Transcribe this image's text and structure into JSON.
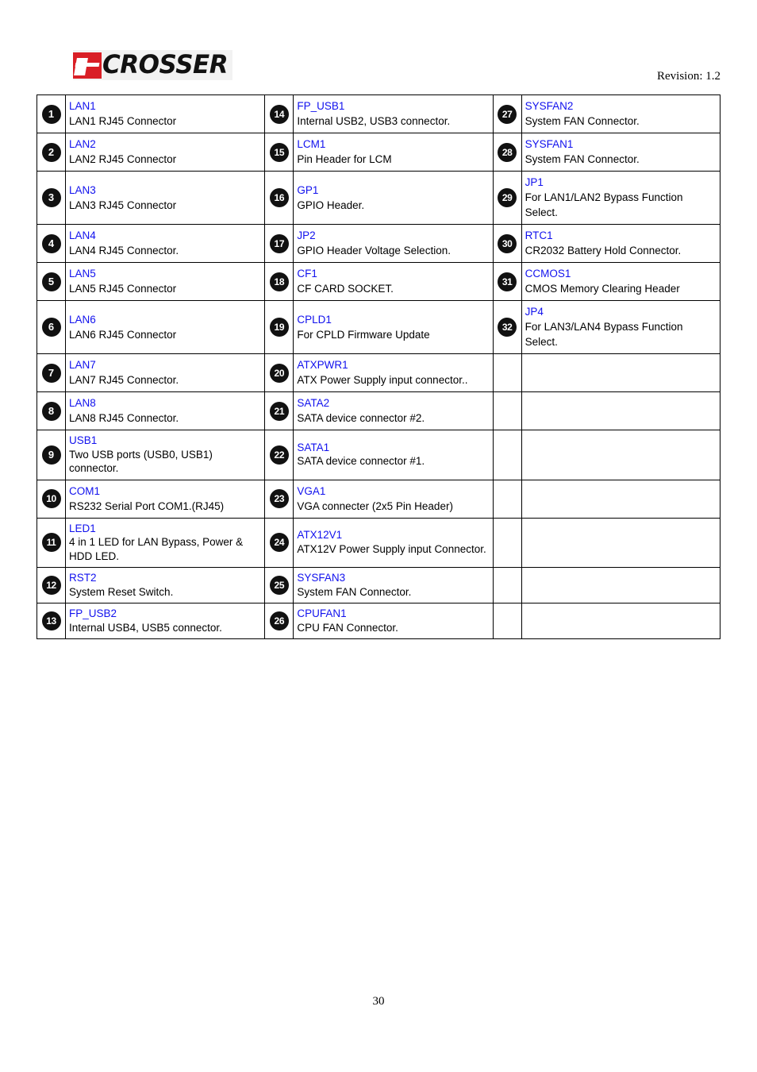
{
  "header": {
    "logo_mark": "acrosser-logo-mark",
    "logo_text": "CROSSER",
    "logo_alt": "ACROSSER",
    "revision": "Revision: 1.2"
  },
  "footer": {
    "page_number": "30"
  },
  "table": {
    "rows": [
      {
        "col1": {
          "num": "1",
          "name": "LAN1",
          "desc": "LAN1 RJ45 Connector"
        },
        "col2": {
          "num": "14",
          "name": "FP_USB1",
          "desc": "Internal USB2, USB3 connector."
        },
        "col3": {
          "num": "27",
          "name": "SYSFAN2",
          "desc": "System FAN Connector."
        }
      },
      {
        "col1": {
          "num": "2",
          "name": "LAN2",
          "desc": "LAN2 RJ45 Connector"
        },
        "col2": {
          "num": "15",
          "name": "LCM1",
          "desc": "Pin Header for LCM"
        },
        "col3": {
          "num": "28",
          "name": "SYSFAN1",
          "desc": "System FAN Connector."
        }
      },
      {
        "col1": {
          "num": "3",
          "name": "LAN3",
          "desc": "LAN3 RJ45 Connector"
        },
        "col2": {
          "num": "16",
          "name": "GP1",
          "desc": "GPIO Header."
        },
        "col3": {
          "num": "29",
          "name": "JP1",
          "desc": "For LAN1/LAN2 Bypass Function Select."
        }
      },
      {
        "col1": {
          "num": "4",
          "name": "LAN4",
          "desc": "LAN4 RJ45 Connector."
        },
        "col2": {
          "num": "17",
          "name": "JP2",
          "desc": "GPIO Header Voltage Selection."
        },
        "col3": {
          "num": "30",
          "name": "RTC1",
          "desc": "CR2032 Battery Hold Connector."
        }
      },
      {
        "col1": {
          "num": "5",
          "name": "LAN5",
          "desc": "LAN5 RJ45 Connector"
        },
        "col2": {
          "num": "18",
          "name": "CF1",
          "desc": "CF CARD SOCKET."
        },
        "col3": {
          "num": "31",
          "name": "CCMOS1",
          "desc": "CMOS Memory Clearing Header"
        }
      },
      {
        "col1": {
          "num": "6",
          "name": "LAN6",
          "desc": "LAN6 RJ45 Connector"
        },
        "col2": {
          "num": "19",
          "name": "CPLD1",
          "desc": "For CPLD Firmware Update"
        },
        "col3": {
          "num": "32",
          "name": "JP4",
          "desc": "For LAN3/LAN4 Bypass Function Select."
        }
      },
      {
        "col1": {
          "num": "7",
          "name": "LAN7",
          "desc": "LAN7 RJ45 Connector."
        },
        "col2": {
          "num": "20",
          "name": "ATXPWR1",
          "desc": "ATX Power Supply input connector.."
        },
        "col3": {
          "num": "",
          "name": "",
          "desc": ""
        }
      },
      {
        "col1": {
          "num": "8",
          "name": "LAN8",
          "desc": "LAN8 RJ45 Connector."
        },
        "col2": {
          "num": "21",
          "name": "SATA2",
          "desc": "SATA device connector #2."
        },
        "col3": {
          "num": "",
          "name": "",
          "desc": ""
        }
      },
      {
        "col1": {
          "num": "9",
          "name": "USB1",
          "desc": "Two USB ports (USB0, USB1) connector."
        },
        "col2": {
          "num": "22",
          "name": "SATA1",
          "desc": "SATA device connector #1."
        },
        "col3": {
          "num": "",
          "name": "",
          "desc": ""
        }
      },
      {
        "col1": {
          "num": "10",
          "name": "COM1",
          "desc": "RS232 Serial Port COM1.(RJ45)"
        },
        "col2": {
          "num": "23",
          "name": "VGA1",
          "desc": "VGA connecter (2x5 Pin Header)"
        },
        "col3": {
          "num": "",
          "name": "",
          "desc": ""
        }
      },
      {
        "col1": {
          "num": "11",
          "name": "LED1",
          "desc": "4 in 1 LED for LAN Bypass, Power & HDD LED."
        },
        "col2": {
          "num": "24",
          "name": "ATX12V1",
          "desc": "ATX12V Power Supply input Connector."
        },
        "col3": {
          "num": "",
          "name": "",
          "desc": ""
        }
      },
      {
        "col1": {
          "num": "12",
          "name": "RST2",
          "desc": "System Reset Switch."
        },
        "col2": {
          "num": "25",
          "name": "SYSFAN3",
          "desc": "System FAN Connector."
        },
        "col3": {
          "num": "",
          "name": "",
          "desc": ""
        }
      },
      {
        "col1": {
          "num": "13",
          "name": "FP_USB2",
          "desc": "Internal USB4, USB5 connector."
        },
        "col2": {
          "num": "26",
          "name": "CPUFAN1",
          "desc": "CPU FAN Connector."
        },
        "col3": {
          "num": "",
          "name": "",
          "desc": ""
        }
      }
    ]
  },
  "colors": {
    "link_blue": "#1111ee",
    "badge_black": "#111111",
    "logo_red": "#d91f26"
  }
}
